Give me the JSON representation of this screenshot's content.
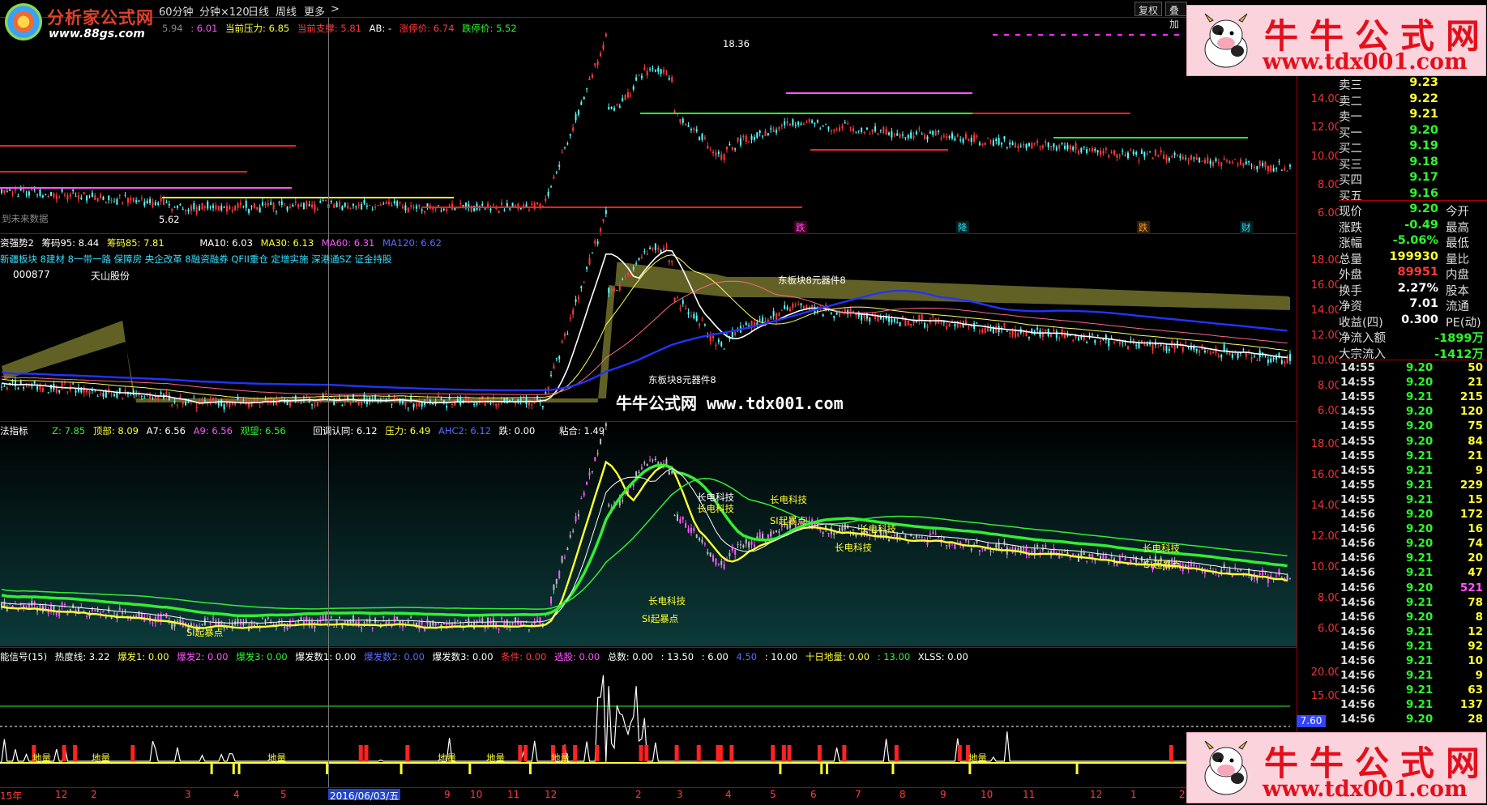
{
  "toolbar": {
    "tabs": [
      "60分钟",
      "分钟×120",
      "日线",
      "周线",
      "更多",
      ">"
    ],
    "buttons": [
      "复权",
      "叠加"
    ]
  },
  "watermark_logo": {
    "brand": "分析家公式网",
    "url": "www.88gs.com"
  },
  "stamp": {
    "line1": "牛牛公式网",
    "line2": "www.tdx001.com"
  },
  "chart_watermark": "牛牛公式网 www.tdx001.com",
  "pane1": {
    "title": [
      {
        "text": "5.94",
        "color": "#888"
      },
      {
        "text": ": 6.01",
        "color": "#ff55ff"
      },
      {
        "text": "当前压力: 6.85",
        "color": "#ffff33"
      },
      {
        "text": "当前支撑: 5.81",
        "color": "#ff3b3b"
      },
      {
        "text": "AB: -",
        "color": "#fff"
      },
      {
        "text": "涨停价: 6.74",
        "color": "#ff3b3b"
      },
      {
        "text": "跌停价: 5.52",
        "color": "#2ef52e"
      }
    ],
    "high_label": "18.36",
    "low_label": "5.62",
    "future_label": "到未来数据",
    "yticks": [
      "14.00",
      "12.00",
      "10.00",
      "8.00",
      "6.00"
    ],
    "markers": [
      "跌",
      "降",
      "跌",
      "财"
    ]
  },
  "pane2": {
    "title": [
      {
        "text": "资强势2",
        "color": "#fff"
      },
      {
        "text": "筹码95: 8.44",
        "color": "#fff"
      },
      {
        "text": "筹码85: 7.81",
        "color": "#ffff33"
      },
      {
        "text": "MA10: 6.03",
        "color": "#fff"
      },
      {
        "text": "MA30: 6.13",
        "color": "#ffff33"
      },
      {
        "text": "MA60: 6.31",
        "color": "#ff55ff"
      },
      {
        "text": "MA120: 6.62",
        "color": "#5a6cff"
      }
    ],
    "concept_line": "新疆板块 8建材 8一带一路 保障房 央企改革 8融资融券 QFII重仓 定增实施 深港通SZ 证金持股",
    "code": "000877",
    "name": "天山股份",
    "label_top": "东板块8元器件8",
    "label_low": "东板块8元器件8",
    "yticks": [
      "18.00",
      "16.00",
      "14.00",
      "12.00",
      "10.00",
      "8.00",
      "6.00"
    ]
  },
  "pane3": {
    "title": [
      {
        "text": "法指标",
        "color": "#fff"
      },
      {
        "text": "Z: 7.85",
        "color": "#2ef52e"
      },
      {
        "text": "顶部: 8.09",
        "color": "#ffff33"
      },
      {
        "text": "A7: 6.56",
        "color": "#fff"
      },
      {
        "text": "A9: 6.56",
        "color": "#ff55ff"
      },
      {
        "text": "观望: 6.56",
        "color": "#2ef52e"
      },
      {
        "text": "回调认同: 6.12",
        "color": "#fff"
      },
      {
        "text": "压力: 6.49",
        "color": "#ffff33"
      },
      {
        "text": "AHC2: 6.12",
        "color": "#5a6cff"
      },
      {
        "text": "跌: 0.00",
        "color": "#fff"
      },
      {
        "text": "粘合: 1.49",
        "color": "#fff"
      }
    ],
    "labels": [
      "长电科技",
      "长电科技",
      "长电科技",
      "长电科技",
      "长电科技",
      "长电科技",
      "长电科技"
    ],
    "sl_label": "SI起暴点",
    "yticks": [
      "18.00",
      "16.00",
      "14.00",
      "12.00",
      "10.00",
      "8.00",
      "6.00"
    ]
  },
  "pane4": {
    "title": [
      {
        "text": "能信号(15)",
        "color": "#fff"
      },
      {
        "text": "热度线: 3.22",
        "color": "#fff"
      },
      {
        "text": "爆发1: 0.00",
        "color": "#ffff33"
      },
      {
        "text": "爆发2: 0.00",
        "color": "#ff55ff"
      },
      {
        "text": "爆发3: 0.00",
        "color": "#2ef52e"
      },
      {
        "text": "爆发数1: 0.00",
        "color": "#fff"
      },
      {
        "text": "爆发数2: 0.00",
        "color": "#5a6cff"
      },
      {
        "text": "爆发数3: 0.00",
        "color": "#fff"
      },
      {
        "text": "条件: 0.00",
        "color": "#ff3b3b"
      },
      {
        "text": "选股: 0.00",
        "color": "#ff55ff"
      },
      {
        "text": "总数: 0.00",
        "color": "#fff"
      },
      {
        "text": ": 13.50",
        "color": "#fff"
      },
      {
        "text": ": 6.00",
        "color": "#fff"
      },
      {
        "text": "4.50",
        "color": "#5a6cff"
      },
      {
        "text": ": 10.00",
        "color": "#fff"
      },
      {
        "text": "十日地量: 0.00",
        "color": "#ffff33"
      },
      {
        "text": ": 13.00",
        "color": "#2ef52e"
      },
      {
        "text": "XLSS: 0.00",
        "color": "#fff"
      }
    ],
    "yticks": [
      "20.00",
      "15.00"
    ],
    "current": "7.60",
    "vol_labels": [
      "地量",
      "地量",
      "地量",
      "地量",
      "地量",
      "地量",
      "地量"
    ]
  },
  "xaxis": {
    "labels": [
      "15年",
      "12",
      "2",
      "3",
      "4",
      "5",
      "2016/06/03/五",
      "9",
      "10",
      "11",
      "12",
      "2",
      "3",
      "4",
      "5",
      "6",
      "7",
      "8",
      "9",
      "10",
      "11",
      "12",
      "1",
      "2"
    ]
  },
  "quote": {
    "order_book": [
      {
        "label": "卖三",
        "price": "9.23",
        "color": "#ffff33"
      },
      {
        "label": "卖二",
        "price": "9.22",
        "color": "#ffff33"
      },
      {
        "label": "卖一",
        "price": "9.21",
        "color": "#ffff33"
      },
      {
        "label": "买一",
        "price": "9.20",
        "color": "#2ef52e"
      },
      {
        "label": "买二",
        "price": "9.19",
        "color": "#2ef52e"
      },
      {
        "label": "买三",
        "price": "9.18",
        "color": "#2ef52e"
      },
      {
        "label": "买四",
        "price": "9.17",
        "color": "#2ef52e"
      },
      {
        "label": "买五",
        "price": "9.16",
        "color": "#2ef52e"
      }
    ],
    "stats": [
      {
        "label": "现价",
        "value": "9.20",
        "color": "#2ef52e",
        "label2": "今开"
      },
      {
        "label": "涨跌",
        "value": "-0.49",
        "color": "#2ef52e",
        "label2": "最高"
      },
      {
        "label": "涨幅",
        "value": "-5.06%",
        "color": "#2ef52e",
        "label2": "最低"
      },
      {
        "label": "总量",
        "value": "199930",
        "color": "#ffff33",
        "label2": "量比"
      },
      {
        "label": "外盘",
        "value": "89951",
        "color": "#ff3b3b",
        "label2": "内盘"
      },
      {
        "label": "换手",
        "value": "2.27%",
        "color": "#fff",
        "label2": "股本"
      },
      {
        "label": "净资",
        "value": "7.01",
        "color": "#fff",
        "label2": "流通"
      },
      {
        "label": "收益(四)",
        "value": "0.300",
        "color": "#fff",
        "label2": "PE(动)"
      }
    ],
    "flows": [
      {
        "label": "净流入额",
        "value": "-1899万",
        "color": "#2ef52e"
      },
      {
        "label": "大宗流入",
        "value": "-1412万",
        "color": "#2ef52e"
      }
    ],
    "ticks": [
      {
        "t": "14:55",
        "p": "9.20",
        "pc": "#2ef52e",
        "v": "50",
        "vc": "#ffff33"
      },
      {
        "t": "14:55",
        "p": "9.20",
        "pc": "#2ef52e",
        "v": "21",
        "vc": "#ffff33"
      },
      {
        "t": "14:55",
        "p": "9.21",
        "pc": "#2ef52e",
        "v": "215",
        "vc": "#ffff33"
      },
      {
        "t": "14:55",
        "p": "9.20",
        "pc": "#2ef52e",
        "v": "120",
        "vc": "#ffff33"
      },
      {
        "t": "14:55",
        "p": "9.20",
        "pc": "#2ef52e",
        "v": "75",
        "vc": "#ffff33"
      },
      {
        "t": "14:55",
        "p": "9.20",
        "pc": "#2ef52e",
        "v": "84",
        "vc": "#ffff33"
      },
      {
        "t": "14:55",
        "p": "9.21",
        "pc": "#2ef52e",
        "v": "21",
        "vc": "#ffff33"
      },
      {
        "t": "14:55",
        "p": "9.21",
        "pc": "#2ef52e",
        "v": "9",
        "vc": "#ffff33"
      },
      {
        "t": "14:55",
        "p": "9.21",
        "pc": "#2ef52e",
        "v": "229",
        "vc": "#ffff33"
      },
      {
        "t": "14:55",
        "p": "9.21",
        "pc": "#2ef52e",
        "v": "15",
        "vc": "#ffff33"
      },
      {
        "t": "14:56",
        "p": "9.20",
        "pc": "#2ef52e",
        "v": "172",
        "vc": "#ffff33"
      },
      {
        "t": "14:56",
        "p": "9.20",
        "pc": "#2ef52e",
        "v": "16",
        "vc": "#ffff33"
      },
      {
        "t": "14:56",
        "p": "9.20",
        "pc": "#2ef52e",
        "v": "74",
        "vc": "#ffff33"
      },
      {
        "t": "14:56",
        "p": "9.21",
        "pc": "#2ef52e",
        "v": "20",
        "vc": "#ffff33"
      },
      {
        "t": "14:56",
        "p": "9.21",
        "pc": "#2ef52e",
        "v": "47",
        "vc": "#ffff33"
      },
      {
        "t": "14:56",
        "p": "9.20",
        "pc": "#2ef52e",
        "v": "521",
        "vc": "#ff55ff"
      },
      {
        "t": "14:56",
        "p": "9.21",
        "pc": "#2ef52e",
        "v": "78",
        "vc": "#ffff33"
      },
      {
        "t": "14:56",
        "p": "9.20",
        "pc": "#2ef52e",
        "v": "8",
        "vc": "#ffff33"
      },
      {
        "t": "14:56",
        "p": "9.21",
        "pc": "#2ef52e",
        "v": "12",
        "vc": "#ffff33"
      },
      {
        "t": "14:56",
        "p": "9.21",
        "pc": "#2ef52e",
        "v": "92",
        "vc": "#ffff33"
      },
      {
        "t": "14:56",
        "p": "9.21",
        "pc": "#2ef52e",
        "v": "10",
        "vc": "#ffff33"
      },
      {
        "t": "14:56",
        "p": "9.21",
        "pc": "#2ef52e",
        "v": "9",
        "vc": "#ffff33"
      },
      {
        "t": "14:56",
        "p": "9.21",
        "pc": "#2ef52e",
        "v": "63",
        "vc": "#ffff33"
      },
      {
        "t": "14:56",
        "p": "9.21",
        "pc": "#2ef52e",
        "v": "137",
        "vc": "#ffff33"
      },
      {
        "t": "14:56",
        "p": "9.20",
        "pc": "#2ef52e",
        "v": "28",
        "vc": "#ffff33"
      }
    ]
  }
}
